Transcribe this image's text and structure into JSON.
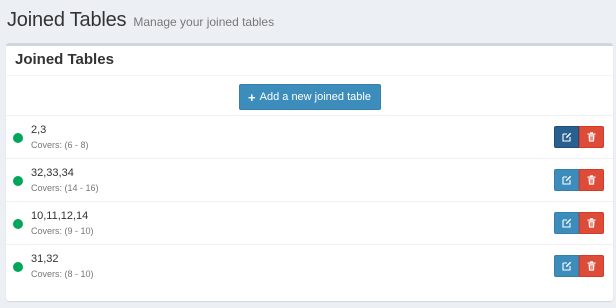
{
  "header": {
    "title": "Joined Tables",
    "subtitle": "Manage your joined tables"
  },
  "box": {
    "title": "Joined Tables",
    "add_button_label": "Add a new joined table",
    "add_button_icon": "plus-icon"
  },
  "colors": {
    "primary": "#3c8dbc",
    "primary_active": "#286090",
    "danger": "#dd4b39",
    "status_active": "#00a65a",
    "page_background": "#ecf0f5"
  },
  "joined_tables": [
    {
      "name": "2,3",
      "covers": "Covers: (6 - 8)",
      "status": "active",
      "edit_icon": "edit-icon",
      "delete_icon": "trash-icon"
    },
    {
      "name": "32,33,34",
      "covers": "Covers: (14 - 16)",
      "status": "active",
      "edit_icon": "edit-icon",
      "delete_icon": "trash-icon"
    },
    {
      "name": "10,11,12,14",
      "covers": "Covers: (9 - 10)",
      "status": "active",
      "edit_icon": "edit-icon",
      "delete_icon": "trash-icon"
    },
    {
      "name": "31,32",
      "covers": "Covers: (8 - 10)",
      "status": "active",
      "edit_icon": "edit-icon",
      "delete_icon": "trash-icon"
    }
  ]
}
